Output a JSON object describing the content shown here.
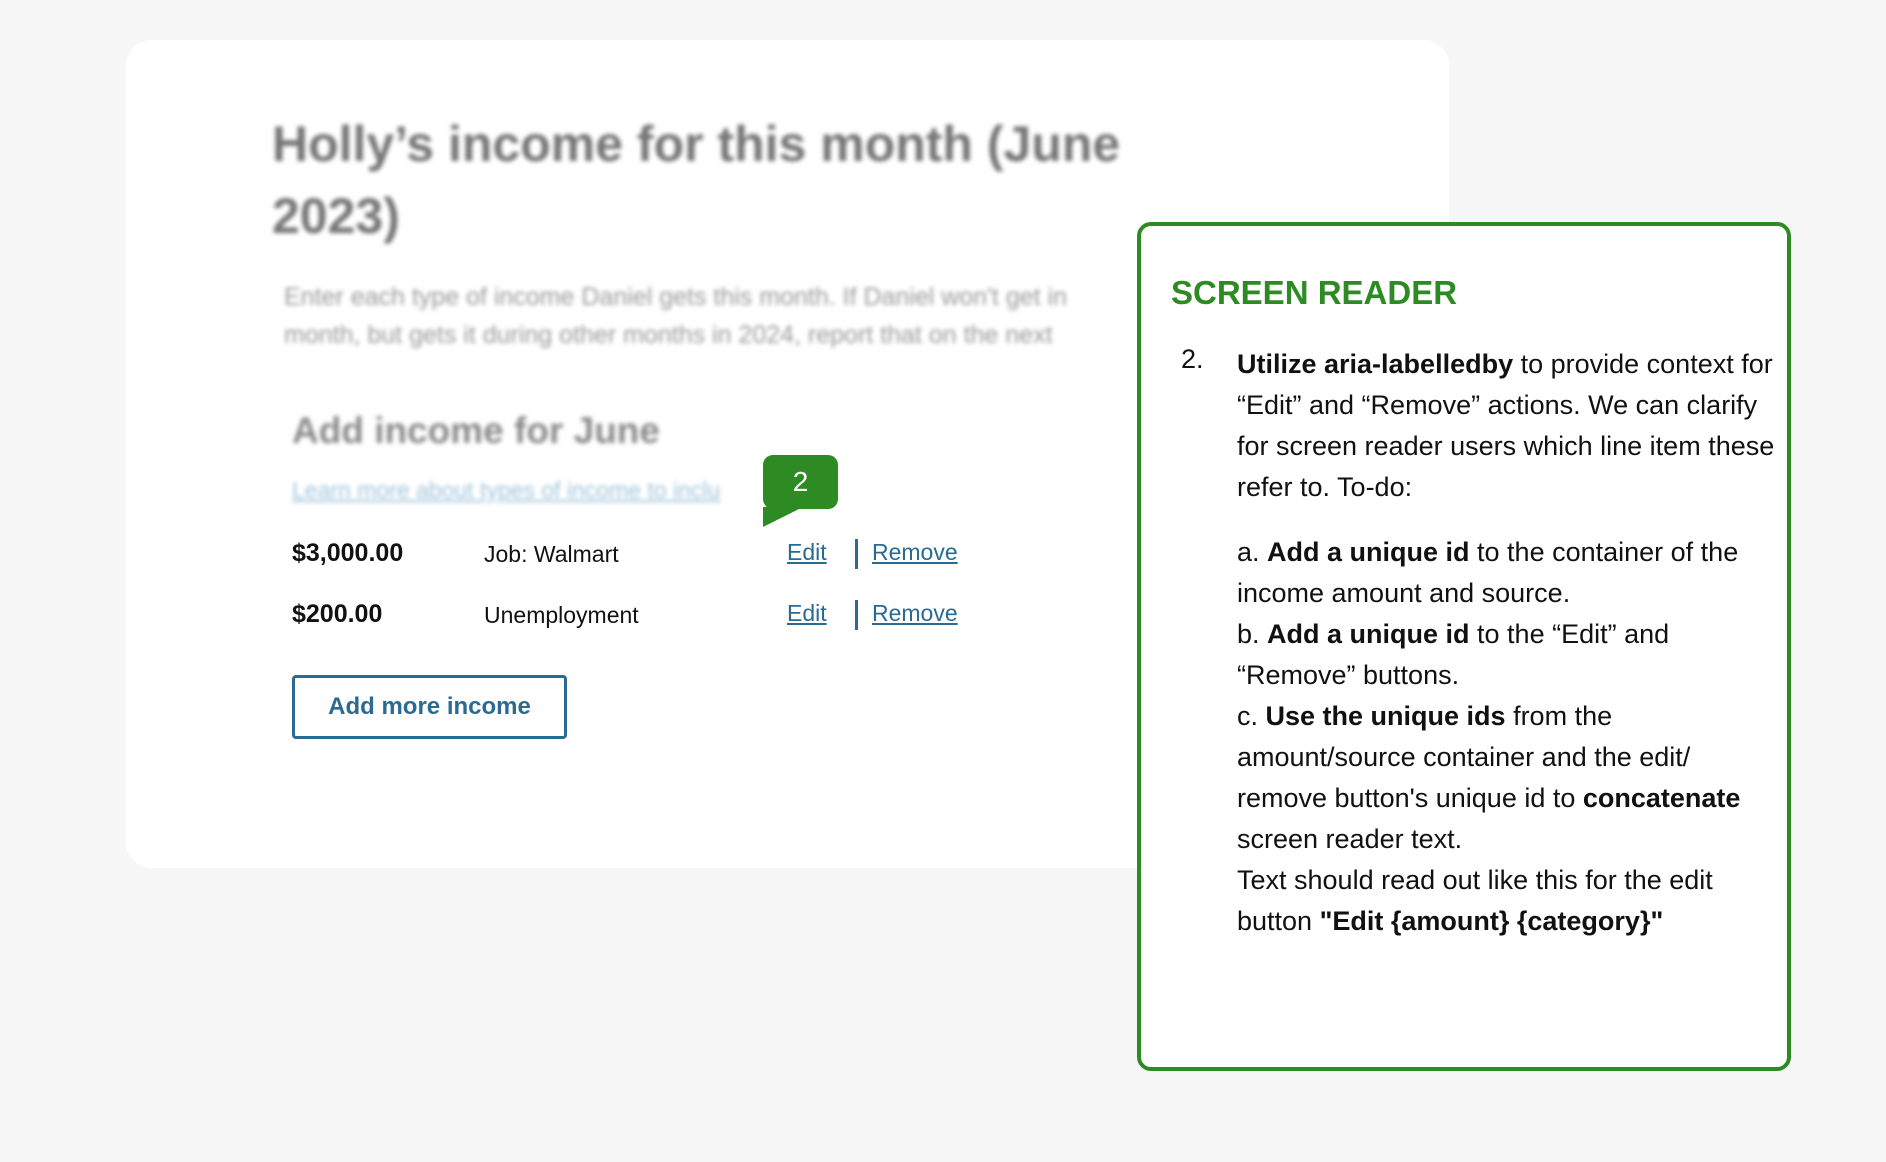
{
  "form": {
    "title": "Holly’s income for this month (June 2023)",
    "intro_line1": "Enter each type of income Daniel gets this month. If Daniel won't get in",
    "intro_line2": "month, but gets it during other months in 2024, report that on the next",
    "section_title": "Add income for June",
    "learn_link": "Learn more about types of income to inclu",
    "rows": [
      {
        "amount": "$3,000.00",
        "source": "Job: Walmart",
        "edit": "Edit",
        "remove": "Remove"
      },
      {
        "amount": "$200.00",
        "source": "Unemployment",
        "edit": "Edit",
        "remove": "Remove"
      }
    ],
    "add_more": "Add more income"
  },
  "marker": {
    "label": "2"
  },
  "note": {
    "heading": "SCREEN READER",
    "number": "2.",
    "intro_bold": "Utilize aria-labelledby",
    "intro_rest": " to provide context for “Edit” and “Remove” actions. We can clarify for screen reader users which line item these refer to. To-do:",
    "todo_a_prefix": "a. ",
    "todo_a_bold": "Add a unique id",
    "todo_a_rest": " to the container of the income amount and source.",
    "todo_b_prefix": "b. ",
    "todo_b_bold": "Add a unique id",
    "todo_b_rest": " to the “Edit” and “Remove” buttons.",
    "todo_c_prefix": "c. ",
    "todo_c_bold": "Use the unique ids",
    "todo_c_rest": " from the amount/source container and the edit/ remove button's unique id to ",
    "todo_c_bold2": "concatenate",
    "todo_c_end": " screen reader text.",
    "closing_text": "Text should read out like this for the edit button ",
    "closing_bold": "\"Edit {amount} {category}\""
  },
  "colors": {
    "accent_green": "#2e8b24",
    "link_blue": "#2b6a93",
    "background": "#f7f7f7"
  }
}
